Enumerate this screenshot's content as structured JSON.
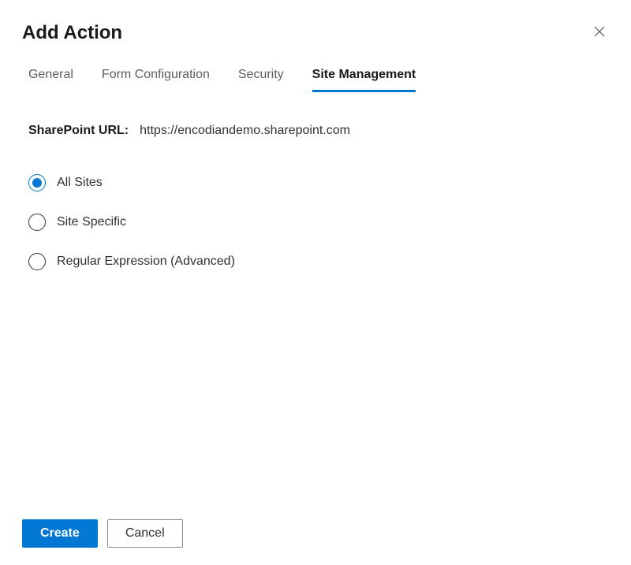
{
  "dialog": {
    "title": "Add Action"
  },
  "tabs": {
    "general": "General",
    "form_configuration": "Form Configuration",
    "security": "Security",
    "site_management": "Site Management"
  },
  "content": {
    "url_label": "SharePoint URL:",
    "url_value": "https://encodiandemo.sharepoint.com"
  },
  "radios": {
    "all_sites": "All Sites",
    "site_specific": "Site Specific",
    "regex": "Regular Expression (Advanced)"
  },
  "footer": {
    "create": "Create",
    "cancel": "Cancel"
  }
}
